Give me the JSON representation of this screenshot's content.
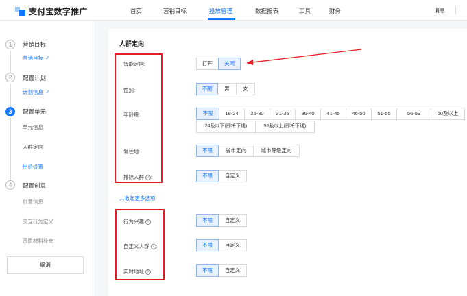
{
  "app": {
    "title": "支付宝数字推广"
  },
  "nav": {
    "items": [
      "首页",
      "营销目标",
      "投放管理",
      "数据报表",
      "工具",
      "财务"
    ],
    "active_index": 2,
    "message": "消息"
  },
  "steps": [
    {
      "num": "1",
      "title": "营销目标",
      "subs": [
        {
          "label": "营销目标",
          "state": "done"
        }
      ]
    },
    {
      "num": "2",
      "title": "配置计划",
      "subs": [
        {
          "label": "计划信息",
          "state": "done"
        }
      ]
    },
    {
      "num": "3",
      "title": "配置单元",
      "subs": [
        {
          "label": "单元信息",
          "state": "normal"
        },
        {
          "label": "人群定向",
          "state": "normal"
        },
        {
          "label": "出价设置",
          "state": "current"
        }
      ]
    },
    {
      "num": "4",
      "title": "配置创意",
      "subs": [
        {
          "label": "创意信息",
          "state": "gray"
        },
        {
          "label": "交互行为定义",
          "state": "gray"
        },
        {
          "label": "资质材料补充",
          "state": "gray"
        }
      ]
    }
  ],
  "cancel_label": "取消",
  "section": {
    "title": "人群定向",
    "fields": {
      "smart": {
        "label": "智能定向:",
        "options": [
          "打开",
          "关闭"
        ],
        "selected": 1
      },
      "gender": {
        "label": "性别:",
        "options": [
          "不限",
          "男",
          "女"
        ],
        "selected": 0
      },
      "age": {
        "label": "年龄段:",
        "options_row1": [
          "不限",
          "18-24",
          "25-30",
          "31-35",
          "36-40",
          "41-45",
          "46-50",
          "51-55",
          "56-59",
          "60及以上"
        ],
        "options_row2": [
          "24及以下(即将下线)",
          "56及以上(即将下线)"
        ],
        "selected": 0
      },
      "location": {
        "label": "常住地:",
        "options": [
          "不限",
          "省市定向",
          "城市等级定向"
        ],
        "selected": 0
      },
      "exclude": {
        "label": "排除人群",
        "options": [
          "不限",
          "自定义"
        ],
        "selected": 0
      }
    },
    "more_toggle": "收起更多选项",
    "advanced": {
      "interest": {
        "label": "行为兴趣",
        "options": [
          "不限",
          "自定义"
        ],
        "selected": 0
      },
      "custom_crowd": {
        "label": "自定义人群",
        "options": [
          "不限",
          "自定义"
        ],
        "selected": 0
      },
      "realtime_location": {
        "label": "实时地址",
        "options": [
          "不限",
          "自定义"
        ],
        "selected": 0
      }
    }
  },
  "colors": {
    "primary": "#1677ff",
    "annotation": "#e51c23",
    "selected_bg": "#e6f0ff"
  },
  "icons": {
    "help": "question-circle-icon",
    "chevron_up": "chevron-up-icon",
    "check": "check-icon"
  }
}
